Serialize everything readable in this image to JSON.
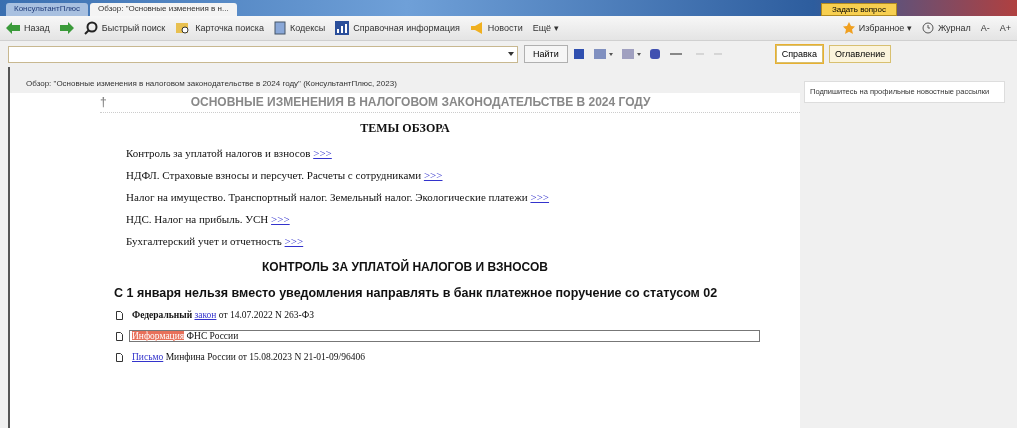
{
  "tabs": [
    {
      "label": "КонсультантПлюс",
      "selected": false
    },
    {
      "label": "Обзор: \"Основные изменения в н...",
      "selected": true
    }
  ],
  "ask_button": "Задать вопрос",
  "toolbar": {
    "left": [
      {
        "label": "Назад",
        "kind": "back"
      },
      {
        "kind": "forward"
      },
      {
        "label": "Быстрый поиск",
        "kind": "search"
      },
      {
        "label": "Карточка поиска",
        "kind": "card"
      },
      {
        "label": "Кодексы",
        "kind": "book"
      },
      {
        "label": "Справочная информация",
        "kind": "chart"
      },
      {
        "label": "Новости",
        "kind": "megaphone"
      },
      {
        "label": "Ещё ▾",
        "kind": "text"
      }
    ],
    "right": [
      {
        "label": "Избранное ▾",
        "kind": "star"
      },
      {
        "label": "Журнал",
        "kind": "clock"
      },
      {
        "label": "А-",
        "kind": "text"
      },
      {
        "label": "А+",
        "kind": "text"
      }
    ]
  },
  "search": {
    "button": "Найти"
  },
  "side_tabs": [
    {
      "label": "Справка",
      "selected": true
    },
    {
      "label": "Оглавление",
      "selected": false
    }
  ],
  "document": {
    "header": "Обзор: \"Основные изменения в налоговом законодательстве в 2024 году\" (КонсультантПлюс, 2023)",
    "marker": "†",
    "title": "ОСНОВНЫЕ ИЗМЕНЕНИЯ В НАЛОГОВОМ ЗАКОНОДАТЕЛЬСТВЕ В 2024 ГОДУ",
    "topics_heading": "ТЕМЫ ОБЗОРА",
    "topics": [
      {
        "text": "Контроль за уплатой налогов и взносов",
        "link": ">>>"
      },
      {
        "text": "НДФЛ. Страховые взносы и персучет. Расчеты с сотрудниками",
        "link": ">>>"
      },
      {
        "text": "Налог на имущество. Транспортный налог. Земельный налог. Экологические платежи",
        "link": ">>>"
      },
      {
        "text": "НДС. Налог на прибыль. УСН",
        "link": ">>>"
      },
      {
        "text": "Бухгалтерский учет и отчетность",
        "link": ">>>"
      }
    ],
    "section_heading": "КОНТРОЛЬ ЗА УПЛАТОЙ НАЛОГОВ И ВЗНОСОВ",
    "subheading": "С 1 января нельзя вместо уведомления направлять в банк платежное поручение со статусом 02",
    "references": [
      {
        "prefix": "Федеральный",
        "link": "закон",
        "rest": "от 14.07.2022 N 263-ФЗ",
        "selected": false
      },
      {
        "link": "Информация",
        "rest": "ФНС России",
        "selected": true
      },
      {
        "link": "Письмо",
        "rest": "Минфина России от 15.08.2023 N 21-01-09/96406",
        "selected": false
      }
    ]
  },
  "side_panel": {
    "notice": "Подпишитесь на профильные новостные рассылки"
  }
}
